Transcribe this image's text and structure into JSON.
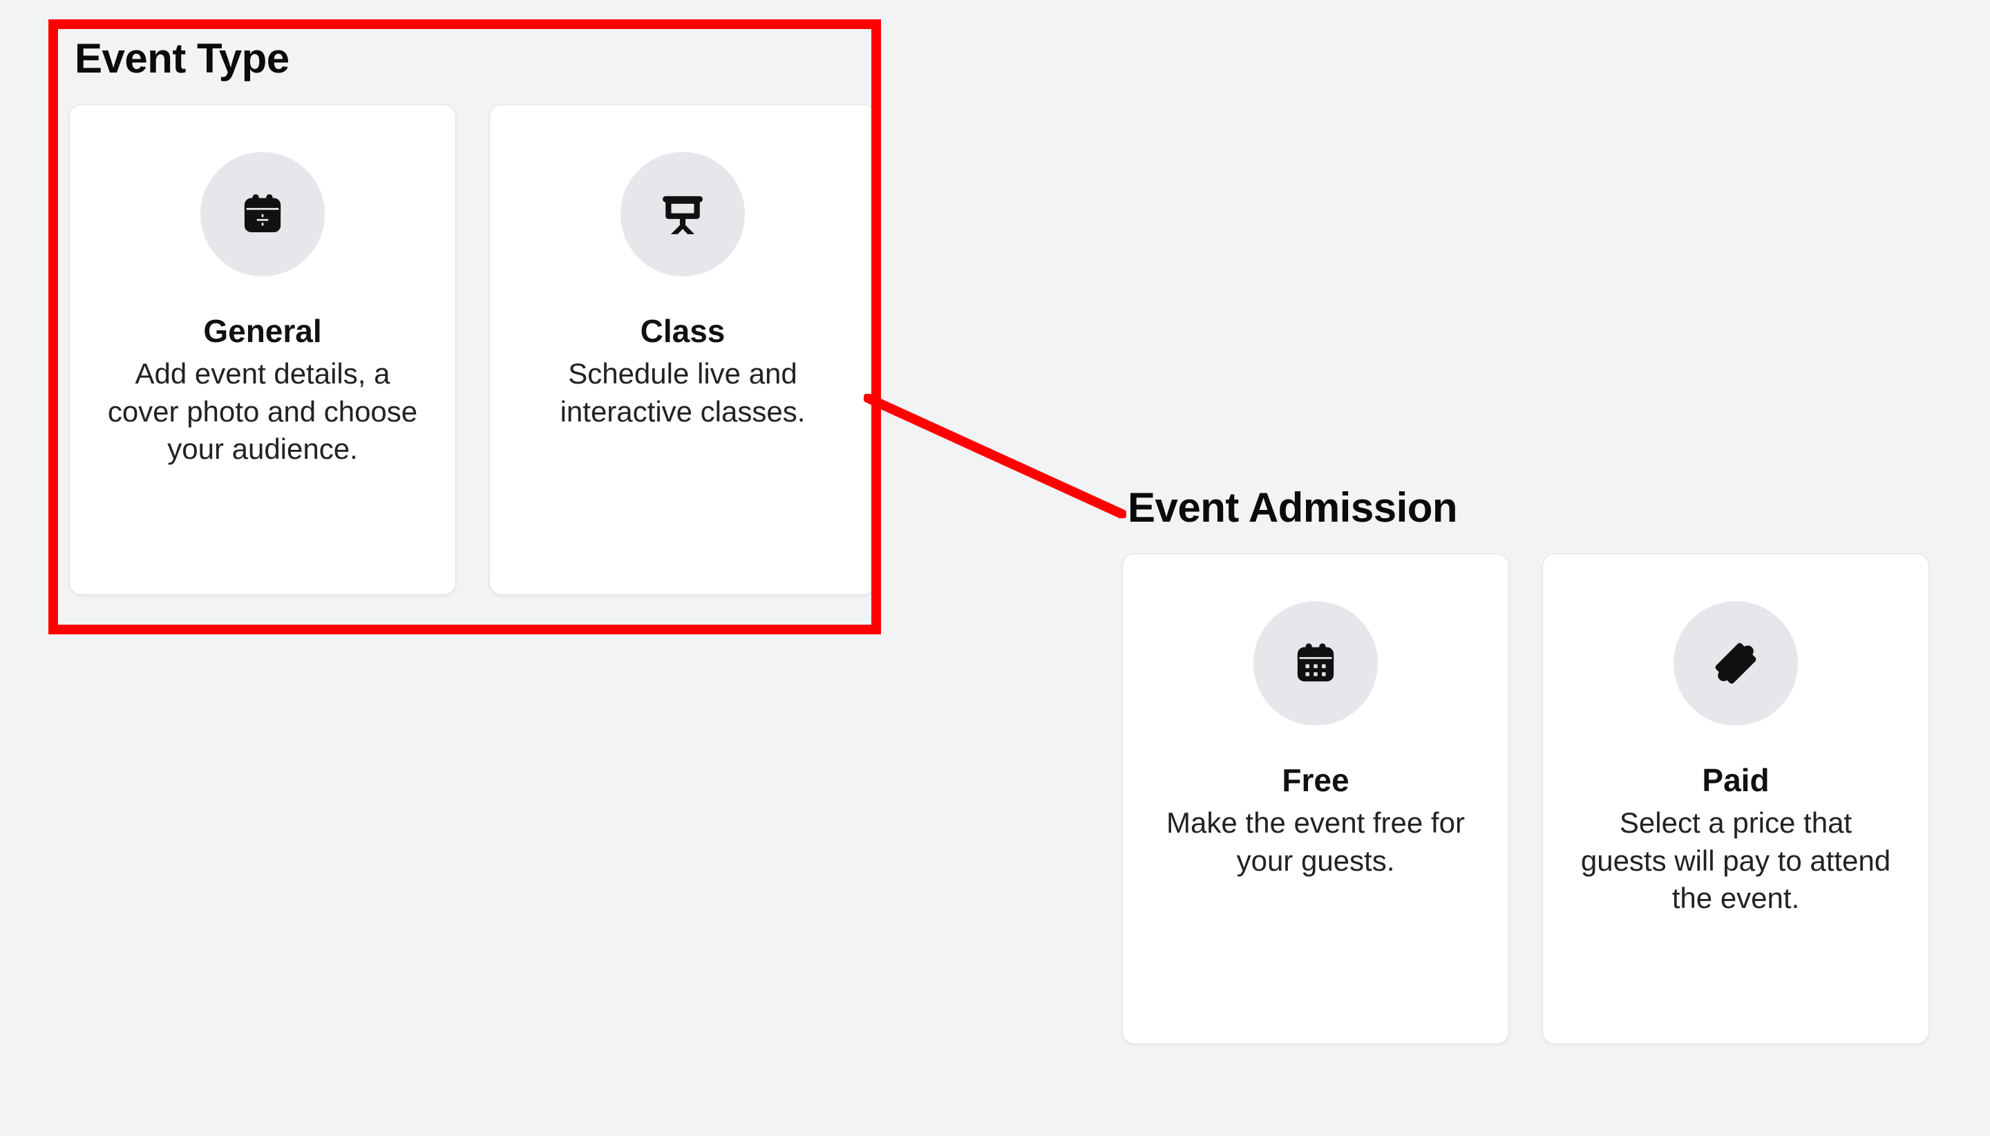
{
  "event_type": {
    "heading": "Event Type",
    "cards": [
      {
        "title": "General",
        "desc": "Add event details, a cover photo and choose your audience."
      },
      {
        "title": "Class",
        "desc": "Schedule live and interactive classes."
      }
    ]
  },
  "event_admission": {
    "heading": "Event Admission",
    "cards": [
      {
        "title": "Free",
        "desc": "Make the event free for your guests."
      },
      {
        "title": "Paid",
        "desc": "Select a price that guests will pay to attend the event."
      }
    ]
  },
  "annotations": {
    "highlight_color": "#ff0000"
  }
}
